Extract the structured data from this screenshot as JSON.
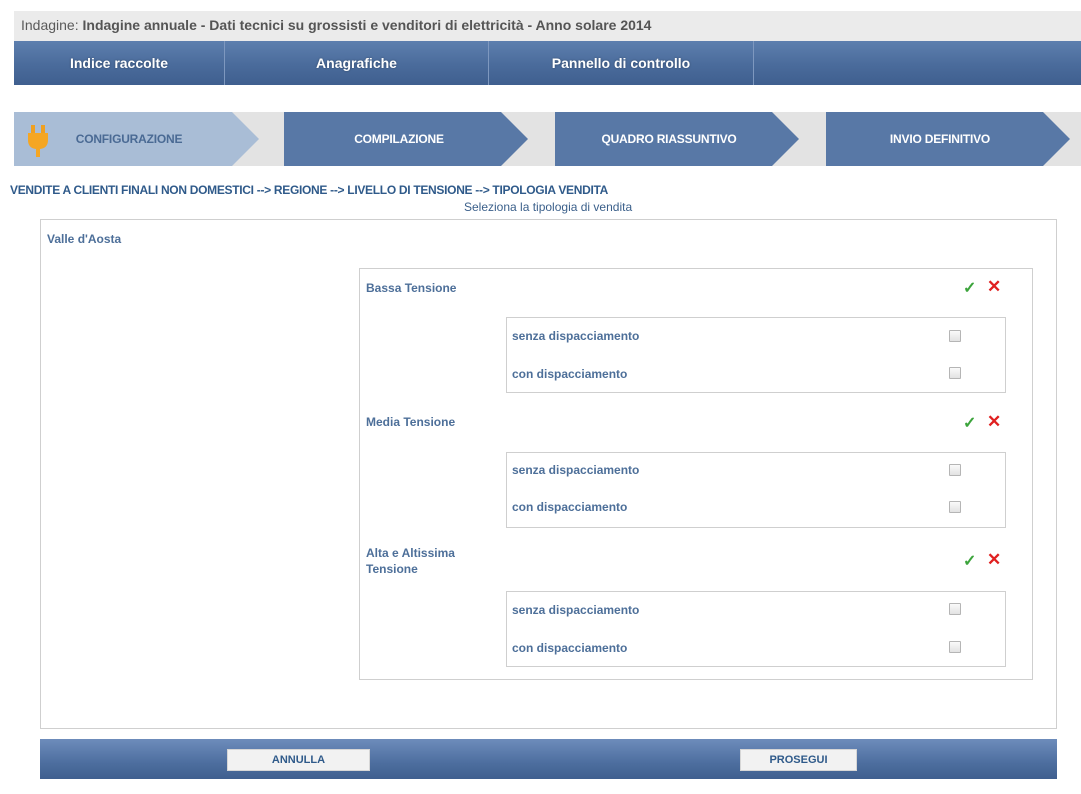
{
  "header": {
    "prefix": "Indagine:",
    "survey_name": "Indagine annuale - Dati tecnici su grossisti e venditori di elettricità - Anno solare 2014"
  },
  "nav": [
    "Indice raccolte",
    "Anagrafiche",
    "Pannello di controllo"
  ],
  "steps": [
    "CONFIGURAZIONE",
    "COMPILAZIONE",
    "QUADRO RIASSUNTIVO",
    "INVIO DEFINITIVO"
  ],
  "breadcrumb": "VENDITE A CLIENTI FINALI NON DOMESTICI --> REGIONE --> LIVELLO DI TENSIONE --> TIPOLOGIA VENDITA",
  "subtitle": "Seleziona la tipologia di vendita",
  "region": "Valle d'Aosta",
  "groups": [
    {
      "label": "Bassa Tensione",
      "options": [
        {
          "label": "senza dispacciamento",
          "checked": false
        },
        {
          "label": "con dispacciamento",
          "checked": false
        }
      ]
    },
    {
      "label": "Media Tensione",
      "options": [
        {
          "label": "senza dispacciamento",
          "checked": false
        },
        {
          "label": "con dispacciamento",
          "checked": false
        }
      ]
    },
    {
      "label": "Alta e Altissima Tensione",
      "options": [
        {
          "label": "senza dispacciamento",
          "checked": false
        },
        {
          "label": "con dispacciamento",
          "checked": false
        }
      ]
    }
  ],
  "icons": {
    "check": "✓",
    "cross": "✕",
    "step_icon": "plug-icon"
  },
  "buttons": {
    "cancel": "ANNULLA",
    "proceed": "PROSEGUI"
  },
  "colors": {
    "nav_blue": "#4a6b9b",
    "step_active_bg": "#a9bdd6",
    "step_inactive_bg": "#5878a6",
    "check_green": "#3ca43c",
    "cross_red": "#e02020"
  }
}
